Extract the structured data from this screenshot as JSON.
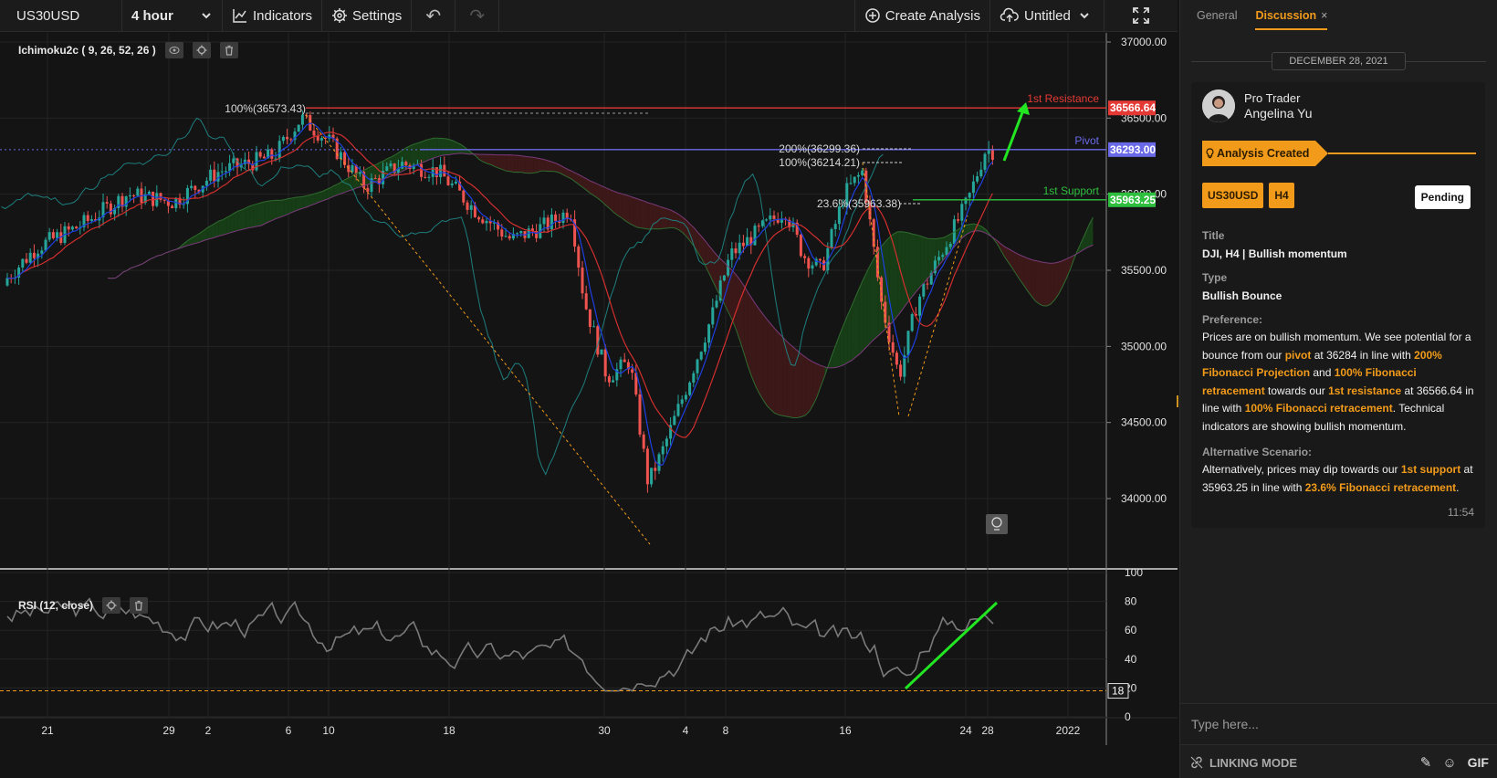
{
  "toolbar": {
    "symbol": "US30USD",
    "interval": "4 hour",
    "indicators_label": "Indicators",
    "settings_label": "Settings",
    "undo_glyph": "↶",
    "redo_glyph": "↷",
    "create_analysis_label": "Create Analysis",
    "layout_name": "Untitled",
    "fullscreen_glyph": "⛶"
  },
  "chart": {
    "indicator_label": "Ichimoku2c ( 9, 26, 52, 26 )",
    "rsi_label": "RSI (12, close)",
    "price_axis": [
      "37000.00",
      "36500.00",
      "36000.00",
      "35500.00",
      "35000.00",
      "34500.00",
      "34000.00"
    ],
    "time_axis": [
      "21",
      "29",
      "2",
      "6",
      "10",
      "18",
      "30",
      "4",
      "8",
      "16",
      "24",
      "28",
      "2022"
    ],
    "rsi_axis": [
      "100",
      "80",
      "60",
      "40",
      "20",
      "0"
    ],
    "rsi_marker": "18",
    "levels": {
      "resistance": {
        "label": "1st Resistance",
        "value": "36566.64",
        "color": "#e53935"
      },
      "pivot": {
        "label": "Pivot",
        "value": "36293.00",
        "color": "#6a6ae8"
      },
      "support": {
        "label": "1st Support",
        "value": "35963.25",
        "color": "#2fbf3f"
      }
    },
    "fib_labels": {
      "top": "100%(36573.43)",
      "proj200": "200%(36299.36)",
      "ret100": "100%(36214.21)",
      "ret236": "23.6%(35963.38)"
    },
    "colors": {
      "bull": "#26a69a",
      "bear": "#ef5350",
      "tenkan": "#1e3fe0",
      "kijun": "#d32f2f",
      "chikou": "#1f8a8a",
      "accent": "#f29b1b",
      "green_arrow": "#22e622"
    }
  },
  "panel": {
    "tabs": [
      "General",
      "Discussion"
    ],
    "tab_close": "×",
    "date": "DECEMBER 28, 2021",
    "author_role": "Pro Trader",
    "author_name": "Angelina Yu",
    "banner": "Analysis Created",
    "tags": [
      "US30USD",
      "H4"
    ],
    "status": "Pending",
    "title_label": "Title",
    "title_value": "DJI, H4 | Bullish momentum",
    "type_label": "Type",
    "type_value": "Bullish Bounce",
    "pref_label": "Preference:",
    "pref": {
      "t1": "Prices are on bullish momentum. We see potential for a bounce from our ",
      "h1": "pivot",
      "t2": " at 36284 in line with ",
      "h2": "200% Fibonacci Projection",
      "t3": " and ",
      "h3": "100% Fibonacci retracement",
      "t4": " towards our ",
      "h4": "1st resistance",
      "t5": " at 36566.64 in line with ",
      "h5": "100% Fibonacci retracement",
      "t6": ". Technical indicators are showing bullish momentum."
    },
    "alt_label": "Alternative Scenario:",
    "alt": {
      "t1": "Alternatively, prices may dip towards our ",
      "h1": "1st support",
      "t2": " at 35963.25 in line with ",
      "h2": "23.6% Fibonacci retracement",
      "t3": "."
    },
    "time": "11:54",
    "input_placeholder": "Type here...",
    "linking_mode": "LINKING MODE",
    "gif": "GIF"
  }
}
